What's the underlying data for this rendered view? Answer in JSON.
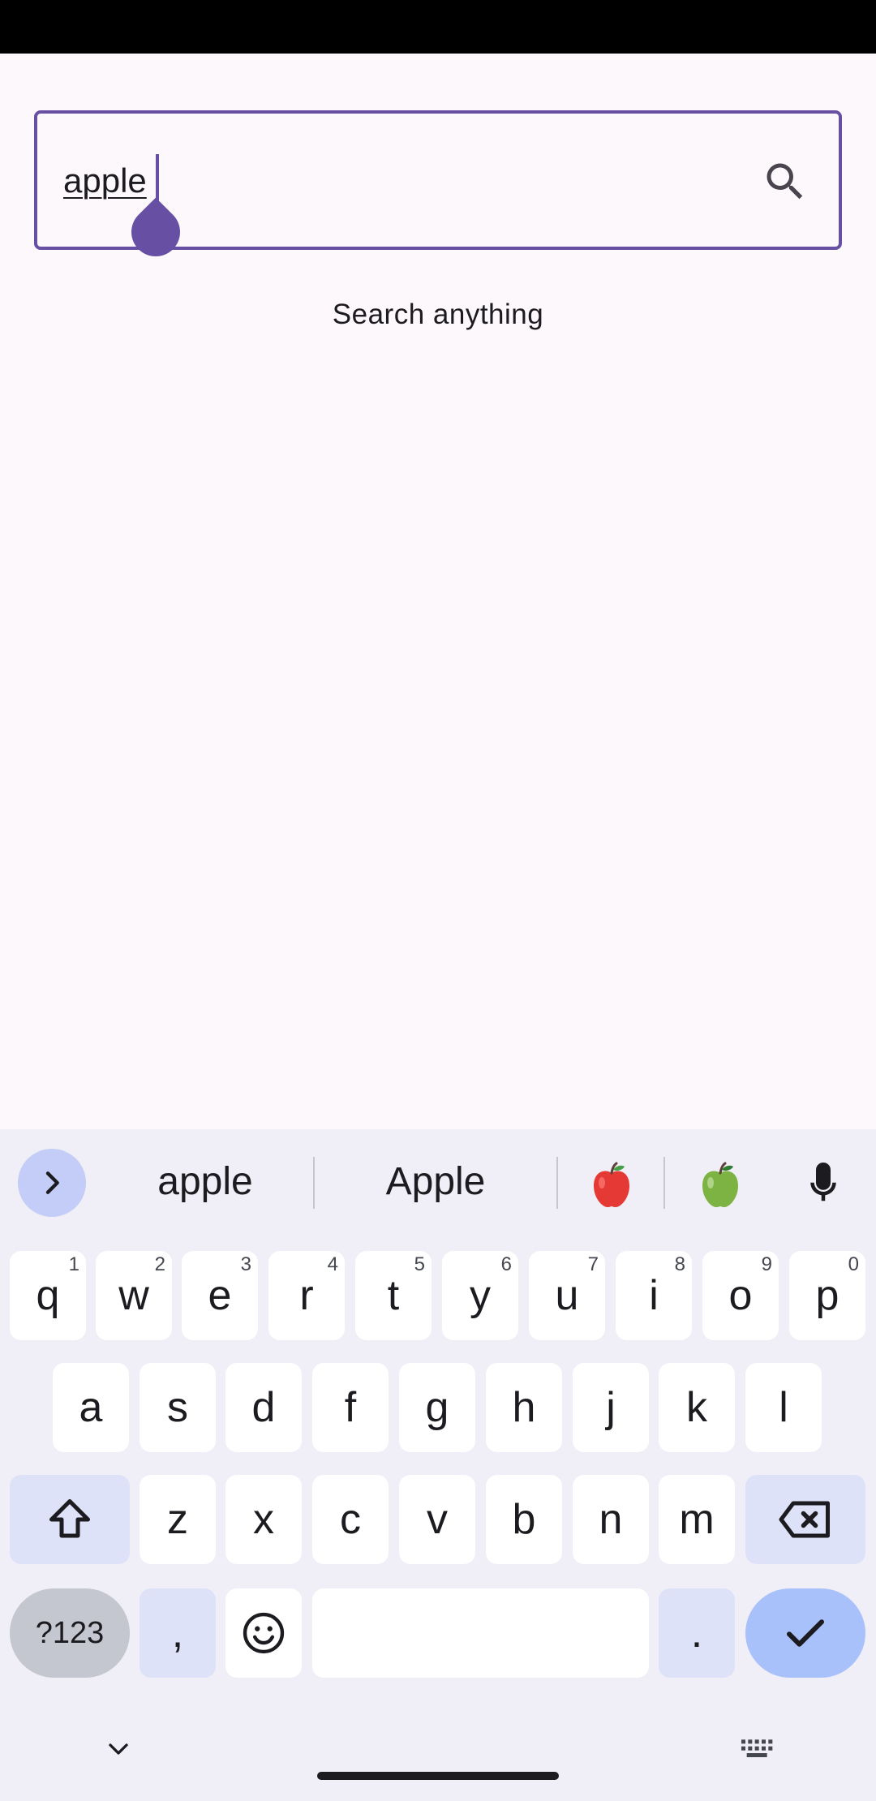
{
  "search": {
    "value": "apple",
    "hint": "Search anything"
  },
  "keyboard": {
    "suggestions": [
      "apple",
      "Apple"
    ],
    "emoji_suggestions": [
      "red-apple-emoji",
      "green-apple-emoji"
    ],
    "row1": [
      {
        "label": "q",
        "hint": "1"
      },
      {
        "label": "w",
        "hint": "2"
      },
      {
        "label": "e",
        "hint": "3"
      },
      {
        "label": "r",
        "hint": "4"
      },
      {
        "label": "t",
        "hint": "5"
      },
      {
        "label": "y",
        "hint": "6"
      },
      {
        "label": "u",
        "hint": "7"
      },
      {
        "label": "i",
        "hint": "8"
      },
      {
        "label": "o",
        "hint": "9"
      },
      {
        "label": "p",
        "hint": "0"
      }
    ],
    "row2": [
      "a",
      "s",
      "d",
      "f",
      "g",
      "h",
      "j",
      "k",
      "l"
    ],
    "row3": [
      "z",
      "x",
      "c",
      "v",
      "b",
      "n",
      "m"
    ],
    "symbols_label": "?123",
    "comma_label": ",",
    "period_label": "."
  },
  "colors": {
    "accent": "#6750a4",
    "background": "#fdf8fc",
    "keyboard_bg": "#f0eef6",
    "key_bg": "#ffffff",
    "mod_key_bg": "#dde2f8",
    "enter_key_bg": "#a9c1fb"
  }
}
